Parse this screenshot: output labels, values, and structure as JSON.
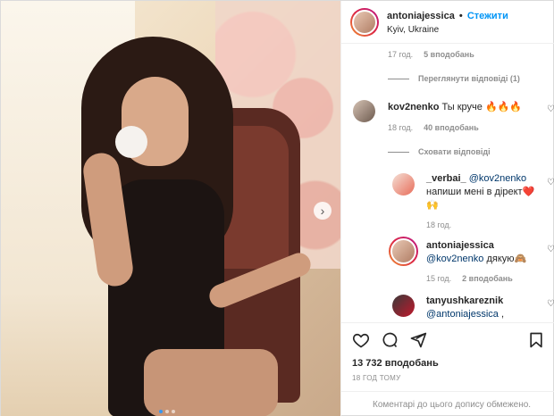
{
  "header": {
    "username": "antoniajessica",
    "separator": "•",
    "follow_label": "Стежити",
    "location": "Kyiv, Ukraine"
  },
  "comments": {
    "top_meta": {
      "time": "17 год.",
      "likes": "5 вподобань"
    },
    "view_replies_label": "Переглянути відповіді (1)",
    "items": [
      {
        "user": "kov2nenko",
        "text": "Ты круче 🔥🔥🔥",
        "time": "18 год.",
        "likes": "40 вподобань"
      }
    ],
    "hide_replies_label": "Сховати відповіді",
    "replies": [
      {
        "user": "_verbai_",
        "mention": "@kov2nenko",
        "text": "напиши мені в дірект❤️",
        "emoji_line": "🙌",
        "time": "18 год."
      },
      {
        "user": "antoniajessica",
        "mention": "@kov2nenko",
        "text": "дякую🙈",
        "time": "15 год.",
        "likes": "2 вподобань"
      },
      {
        "user": "tanyushkareznik",
        "mention": "@antoniajessica",
        "text": ","
      }
    ]
  },
  "actions": {
    "likes_label": "13 732 вподобань",
    "time_ago": "18 ГОД ТОМУ",
    "restricted_note": "Коментарі до цього допису обмежено."
  },
  "carousel": {
    "next_glyph": "›",
    "count": 3,
    "active_index": 0
  },
  "colors": {
    "link": "#0095f6",
    "mention": "#00376b",
    "muted": "#8e8e8e",
    "active_dot": "#3897f0"
  }
}
